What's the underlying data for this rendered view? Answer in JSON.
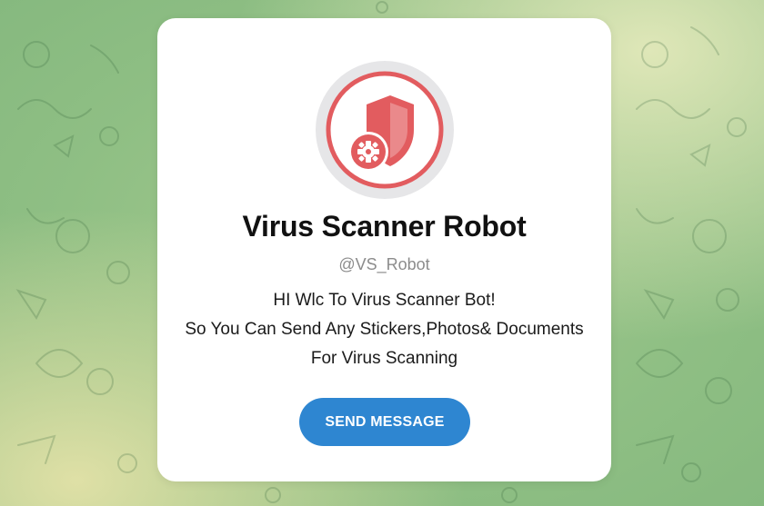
{
  "bot": {
    "name": "Virus Scanner Robot",
    "username": "@VS_Robot",
    "avatar_icon": "shield-gear-icon",
    "description_lines": [
      "HI Wlc To Virus Scanner Bot!",
      "So You Can Send Any Stickers,Photos& Documents",
      "For Virus Scanning"
    ]
  },
  "actions": {
    "send_message_label": "SEND MESSAGE"
  },
  "colors": {
    "accent": "#2e86d1",
    "icon_red": "#e25c5f",
    "background_green": "#8fbf84"
  }
}
